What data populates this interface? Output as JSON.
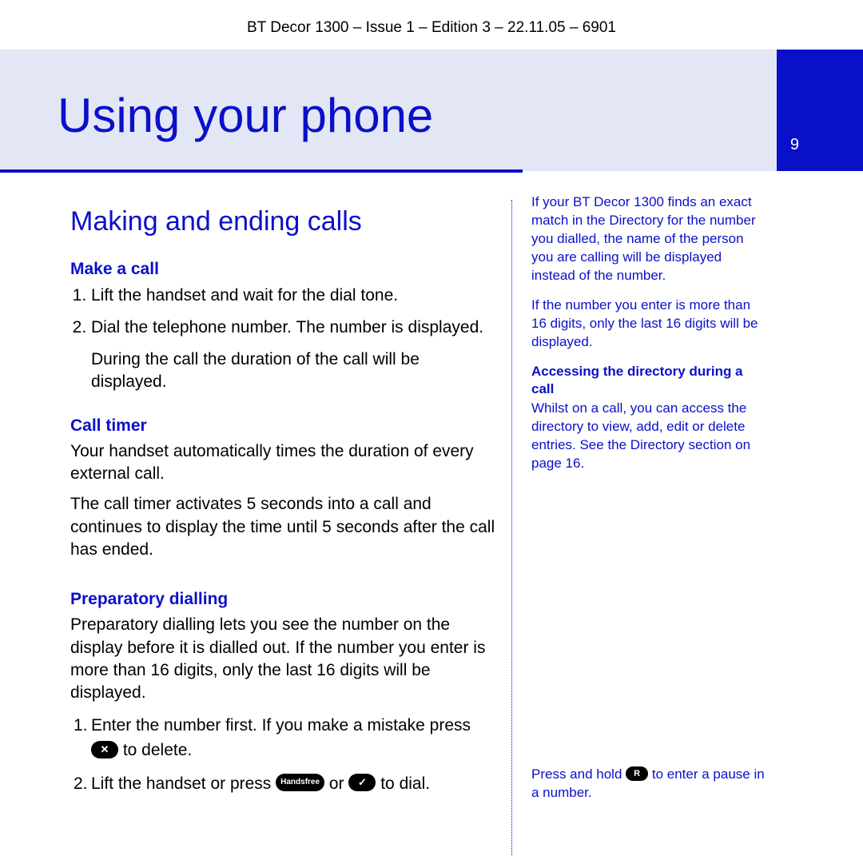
{
  "header_meta": "BT Decor 1300 – Issue 1 – Edition 3 – 22.11.05 – 6901",
  "chapter_title": "Using your phone",
  "page_number": "9",
  "section": {
    "title": "Making and ending calls",
    "make_a_call": {
      "heading": "Make a call",
      "step1": "Lift the handset and wait for the dial tone.",
      "step2": "Dial the telephone number. The number is displayed.",
      "note": "During the call the duration of the call will be displayed."
    },
    "call_timer": {
      "heading": "Call timer",
      "p1": "Your handset automatically times the duration of every external call.",
      "p2": "The call timer activates 5 seconds into a call and continues to display the time until 5 seconds after the call has ended."
    },
    "prep_dial": {
      "heading": "Preparatory dialling",
      "p1": "Preparatory dialling lets you see the number on the display before it is dialled out. If the number you enter is more than 16 digits, only the last 16 digits will be displayed.",
      "step1_pre": "Enter the number first. If you make a mistake press ",
      "step1_post": " to delete.",
      "step2_pre": "Lift the handset or press ",
      "step2_mid": " or ",
      "step2_post": " to dial."
    }
  },
  "icons": {
    "delete_label": "",
    "handsfree_label": "Handsfree",
    "dial_confirm_label": "",
    "pause_label": "R"
  },
  "sidebar": {
    "para1": "If your BT Decor 1300 finds an exact match in the Directory for the number you dialled, the name of the person you are calling will be displayed instead of the number.",
    "para2": "If the number you enter is more than 16 digits, only the last 16 digits will be displayed.",
    "strong_heading": "Accessing the directory during a call",
    "para3": "Whilst on a call, you can access the directory to view, add, edit or delete entries. See the Directory section on page 16.",
    "bottom_pre": "Press and hold ",
    "bottom_post": " to enter a pause in a number."
  }
}
